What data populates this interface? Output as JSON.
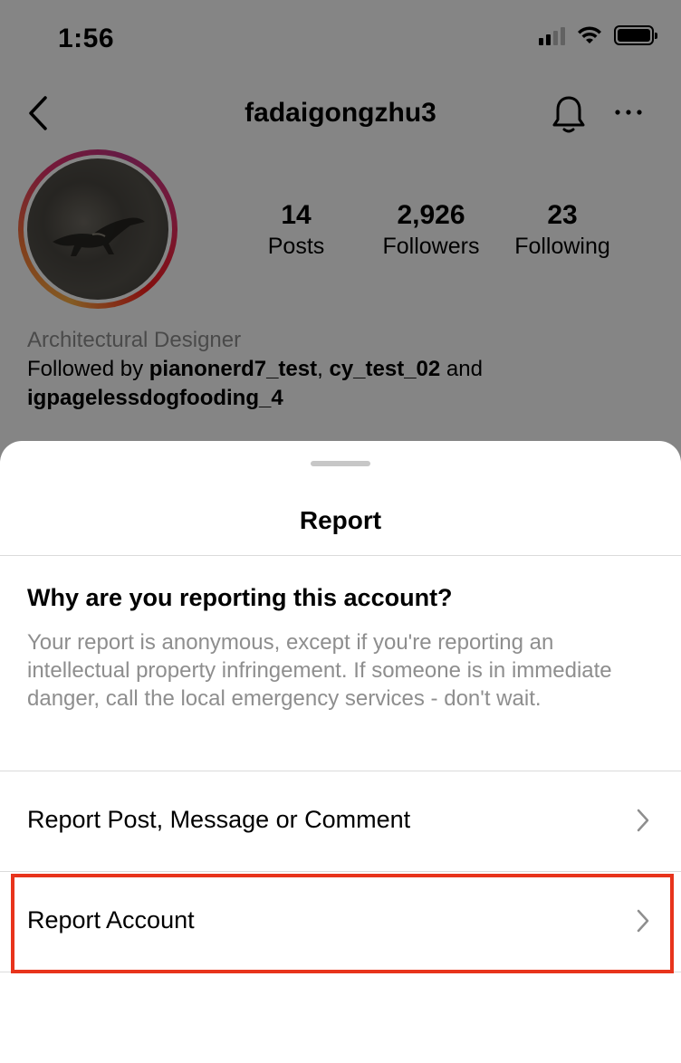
{
  "status_bar": {
    "time": "1:56"
  },
  "profile": {
    "username": "fadaigongzhu3",
    "stats": [
      {
        "value": "14",
        "label": "Posts"
      },
      {
        "value": "2,926",
        "label": "Followers"
      },
      {
        "value": "23",
        "label": "Following"
      }
    ],
    "category": "Architectural Designer",
    "followed_by_prefix": "Followed by ",
    "followed_by_user1": "pianonerd7_test",
    "followed_by_sep": ", ",
    "followed_by_user2": "cy_test_02",
    "followed_by_and": " and ",
    "followed_by_user3": "igpagelessdogfooding_4"
  },
  "sheet": {
    "title": "Report",
    "question": "Why are you reporting this account?",
    "explanation": "Your report is anonymous, except if you're reporting an intellectual property infringement. If someone is in immediate danger, call the local emergency services - don't wait.",
    "options": [
      {
        "label": "Report Post, Message or Comment",
        "icon": "chevron-right-icon"
      },
      {
        "label": "Report Account",
        "icon": "chevron-right-icon"
      }
    ]
  },
  "colors": {
    "highlight": "#e8341c",
    "secondary_text": "#8e8e8e",
    "divider": "#dbdbdb",
    "overlay": "rgba(0,0,0,0.48)"
  }
}
